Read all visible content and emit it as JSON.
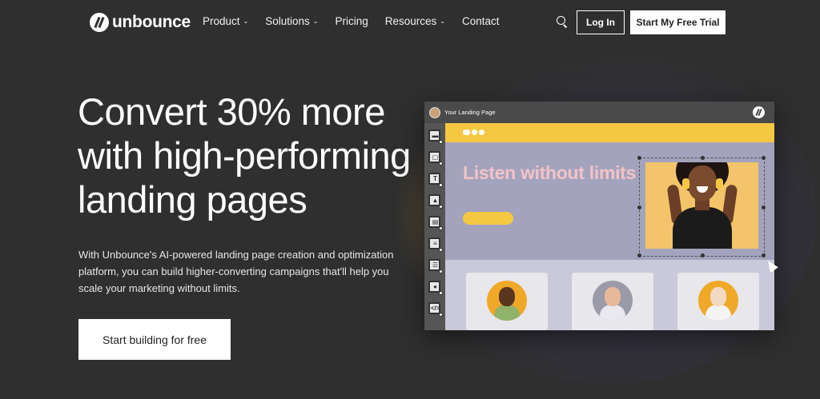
{
  "brand": {
    "name": "unbounce"
  },
  "nav": {
    "items": [
      {
        "label": "Product",
        "dropdown": true
      },
      {
        "label": "Solutions",
        "dropdown": true
      },
      {
        "label": "Pricing",
        "dropdown": false
      },
      {
        "label": "Resources",
        "dropdown": true
      },
      {
        "label": "Contact",
        "dropdown": false
      }
    ],
    "search_icon": "search-icon",
    "login_label": "Log In",
    "trial_label": "Start My Free Trial"
  },
  "hero": {
    "title": "Convert 30% more with high-performing landing pages",
    "description": "With Unbounce's AI-powered landing page creation and optimization platform, you can build higher-converting campaigns that'll help you scale your marketing without limits.",
    "cta_label": "Start building for free"
  },
  "editor": {
    "title": "Your Landing Page",
    "heading": "Listen without limits",
    "tools": [
      "section-icon",
      "box-icon",
      "text-icon",
      "image-icon",
      "image-text-icon",
      "form-icon",
      "list-icon",
      "video-icon",
      "code-icon"
    ],
    "colors": {
      "accent_yellow": "#f5c842",
      "canvas_purple": "#a3a3bd",
      "heading_pink": "#f3c3c8"
    }
  }
}
